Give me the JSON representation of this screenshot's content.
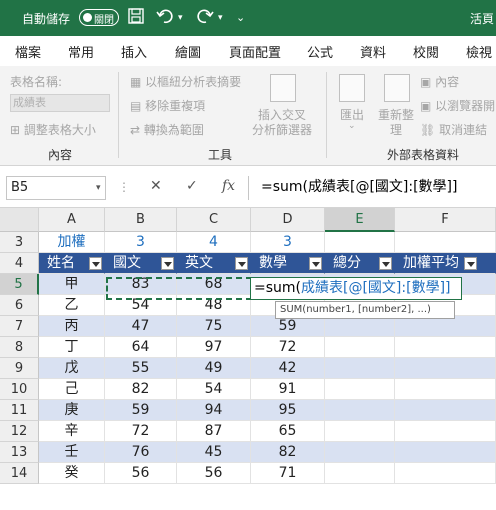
{
  "titlebar": {
    "autosave_label": "自動儲存",
    "toggle_label": "關閉",
    "app_title": "活頁"
  },
  "tabs": [
    "檔案",
    "常用",
    "插入",
    "繪圖",
    "頁面配置",
    "公式",
    "資料",
    "校閱",
    "檢視"
  ],
  "ribbon": {
    "table_name_label": "表格名稱:",
    "table_name_value": "成績表",
    "resize_table": "調整表格大小",
    "group_properties": "內容",
    "pivot_summary": "以樞紐分析表摘要",
    "remove_duplicates": "移除重複項",
    "convert_range": "轉換為範圍",
    "insert_slicer_1": "插入交叉",
    "insert_slicer_2": "分析篩選器",
    "group_tools": "工具",
    "export": "匯出",
    "refresh_1": "重新整",
    "refresh_2": "理",
    "properties": "內容",
    "open_in_browser": "以瀏覽器開",
    "unlink": "取消連結",
    "group_external": "外部表格資料"
  },
  "formula": {
    "name_box": "B5",
    "cancel": "✕",
    "enter": "✓",
    "fx": "fx",
    "content": "=sum(成績表[@[國文]:[數學]]"
  },
  "columns": [
    "A",
    "B",
    "C",
    "D",
    "E",
    "F"
  ],
  "rows": [
    "3",
    "4",
    "5",
    "6",
    "7",
    "8",
    "9",
    "10",
    "11",
    "12",
    "13",
    "14"
  ],
  "weights": {
    "label": "加權",
    "b": "3",
    "c": "4",
    "d": "3"
  },
  "table_headers": [
    "姓名",
    "國文",
    "英文",
    "數學",
    "總分",
    "加權平均"
  ],
  "table_rows": [
    {
      "name": "甲",
      "b": "83",
      "c": "68",
      "d": ""
    },
    {
      "name": "乙",
      "b": "54",
      "c": "48",
      "d": ""
    },
    {
      "name": "丙",
      "b": "47",
      "c": "75",
      "d": "59"
    },
    {
      "name": "丁",
      "b": "64",
      "c": "97",
      "d": "72"
    },
    {
      "name": "戊",
      "b": "55",
      "c": "49",
      "d": "42"
    },
    {
      "name": "己",
      "b": "82",
      "c": "54",
      "d": "91"
    },
    {
      "name": "庚",
      "b": "59",
      "c": "94",
      "d": "95"
    },
    {
      "name": "辛",
      "b": "72",
      "c": "87",
      "d": "65"
    },
    {
      "name": "壬",
      "b": "76",
      "c": "45",
      "d": "82"
    },
    {
      "name": "癸",
      "b": "56",
      "c": "56",
      "d": "71"
    }
  ],
  "edit": {
    "prefix": "=sum(",
    "ref": "成績表[@[國文]:[數學]]",
    "tooltip": "SUM(number1, [number2], ...)"
  },
  "colors": {
    "excel_green": "#217346",
    "table_header": "#2f5597",
    "band": "#d9e1f2",
    "weight_blue": "#1f6fbf"
  }
}
